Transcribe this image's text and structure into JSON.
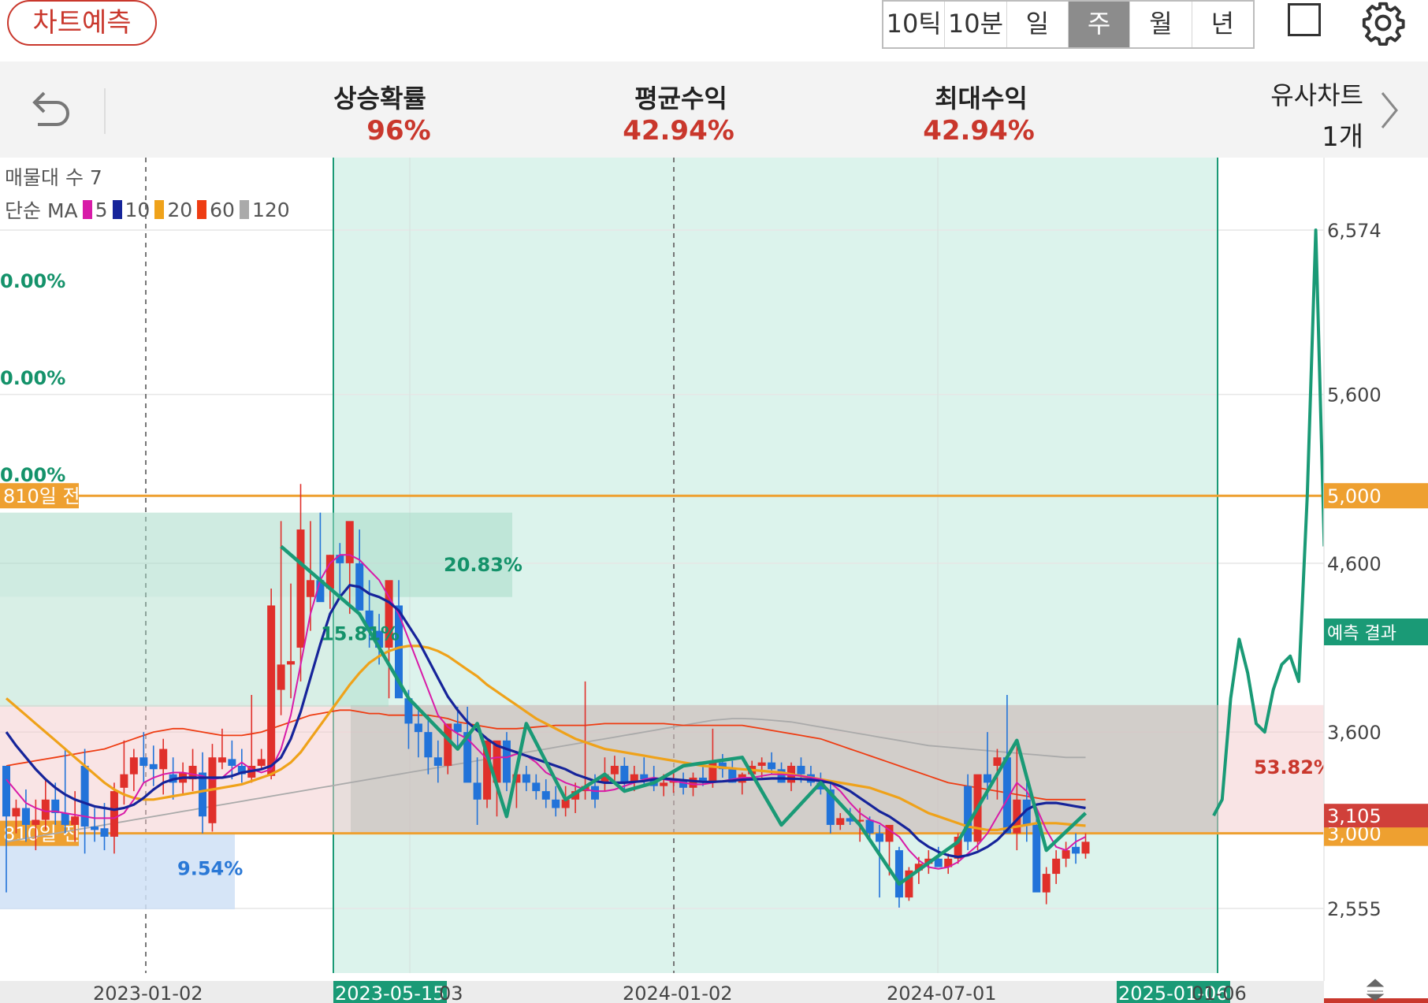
{
  "header": {
    "predict_button": "차트예측",
    "timeframes": [
      "10틱",
      "10분",
      "일",
      "주",
      "월",
      "년"
    ],
    "active_timeframe": "주"
  },
  "stats": {
    "rise_prob_label": "상승확률",
    "rise_prob_value": "96%",
    "avg_return_label": "평균수익",
    "avg_return_value": "42.94%",
    "max_return_label": "최대수익",
    "max_return_value": "42.94%",
    "similar_label": "유사차트",
    "similar_value": "1개"
  },
  "legend": {
    "volume_profile": "매물대 수 7",
    "ma_label": "단순 MA",
    "ma_periods": [
      "5",
      "10",
      "20",
      "60",
      "120"
    ],
    "ma_colors": [
      "#d81ba8",
      "#16249a",
      "#efa21a",
      "#ee3c12",
      "#aaaaaa"
    ]
  },
  "colors": {
    "up": "#e0302b",
    "down": "#2273d9",
    "pattern": "#1a9a76",
    "prediction": "#1a9a76",
    "level_line": "#eea030"
  },
  "chart_data": {
    "type": "candlestick",
    "y_axis_ticks": [
      "6,574",
      "5,600",
      "4,600",
      "3,600",
      "2,555"
    ],
    "y_tick_values": [
      6574,
      5600,
      4600,
      3600,
      2555
    ],
    "x_axis_labels": [
      "2023-01-02",
      "2023-05-15",
      "03",
      "2024-01-02",
      "2024-07-01",
      "2025-01-06",
      "01-06"
    ],
    "level_lines": [
      {
        "value": 5000,
        "value_label": "5,000",
        "left_label": "810일 전"
      },
      {
        "value": 3000,
        "value_label": "3,000",
        "left_label": "810일 전"
      }
    ],
    "current_price": "3,105",
    "current_price_value": 3105,
    "left_percent_labels": [
      "0.00%",
      "0.00%",
      "0.00%"
    ],
    "box_labels": [
      "20.83%",
      "15.81%",
      "9.54%",
      "53.82%"
    ],
    "prediction_label": "예측 결과",
    "ohlc": [
      [
        3400,
        3350,
        2650,
        3100
      ],
      [
        3100,
        3200,
        3000,
        3150
      ],
      [
        3150,
        3260,
        2950,
        3050
      ],
      [
        3050,
        3200,
        2900,
        3080
      ],
      [
        3080,
        3320,
        3020,
        3200
      ],
      [
        3200,
        3300,
        3050,
        3120
      ],
      [
        3120,
        3500,
        3000,
        3050
      ],
      [
        3050,
        3250,
        2950,
        3100
      ],
      [
        3400,
        3500,
        2880,
        3040
      ],
      [
        3040,
        3150,
        2950,
        3020
      ],
      [
        3030,
        3180,
        2900,
        2980
      ],
      [
        2980,
        3300,
        2880,
        3250
      ],
      [
        3270,
        3550,
        3170,
        3350
      ],
      [
        3350,
        3500,
        3250,
        3450
      ],
      [
        3450,
        3600,
        3300,
        3400
      ],
      [
        3410,
        3520,
        3280,
        3380
      ],
      [
        3380,
        3560,
        3230,
        3500
      ],
      [
        3350,
        3450,
        3200,
        3300
      ],
      [
        3300,
        3420,
        3230,
        3360
      ],
      [
        3320,
        3500,
        3250,
        3400
      ],
      [
        3360,
        3480,
        3000,
        3100
      ],
      [
        3060,
        3530,
        3010,
        3450
      ],
      [
        3420,
        3620,
        3380,
        3450
      ],
      [
        3440,
        3550,
        3320,
        3400
      ],
      [
        3400,
        3500,
        3300,
        3350
      ],
      [
        3330,
        3820,
        3300,
        3400
      ],
      [
        3400,
        3500,
        3380,
        3440
      ],
      [
        3340,
        4450,
        3320,
        4350
      ],
      [
        3850,
        4850,
        3700,
        4000
      ],
      [
        4000,
        4480,
        3800,
        4020
      ],
      [
        4100,
        5070,
        3900,
        4800
      ],
      [
        4400,
        4850,
        4200,
        4500
      ],
      [
        4500,
        4900,
        4450,
        4370
      ],
      [
        4450,
        4650,
        4330,
        4650
      ],
      [
        4650,
        4720,
        4400,
        4600
      ],
      [
        4600,
        4800,
        4300,
        4850
      ],
      [
        4600,
        4800,
        4450,
        4320
      ],
      [
        4320,
        4500,
        4100,
        4200
      ],
      [
        4200,
        4300,
        4000,
        4100
      ],
      [
        4100,
        4250,
        3800,
        4500
      ],
      [
        4350,
        4500,
        4150,
        3800
      ],
      [
        3800,
        3850,
        3500,
        3650
      ],
      [
        3650,
        3750,
        3450,
        3600
      ],
      [
        3600,
        3700,
        3350,
        3450
      ],
      [
        3450,
        3550,
        3300,
        3400
      ],
      [
        3400,
        3550,
        3350,
        3650
      ],
      [
        3650,
        3750,
        3500,
        3600
      ],
      [
        3600,
        3750,
        3400,
        3300
      ],
      [
        3300,
        3450,
        3050,
        3200
      ],
      [
        3200,
        3550,
        3150,
        3550
      ],
      [
        3300,
        3500,
        3100,
        3550
      ],
      [
        3550,
        3600,
        3250,
        3300
      ],
      [
        3300,
        3400,
        3150,
        3350
      ],
      [
        3350,
        3400,
        3250,
        3300
      ],
      [
        3300,
        3350,
        3200,
        3250
      ],
      [
        3250,
        3320,
        3150,
        3200
      ],
      [
        3200,
        3280,
        3100,
        3150
      ],
      [
        3150,
        3280,
        3100,
        3200
      ],
      [
        3200,
        3300,
        3120,
        3250
      ],
      [
        3250,
        3900,
        3200,
        3280
      ],
      [
        3280,
        3350,
        3150,
        3200
      ],
      [
        3300,
        3450,
        3250,
        3350
      ],
      [
        3350,
        3460,
        3300,
        3400
      ],
      [
        3400,
        3450,
        3250,
        3300
      ],
      [
        3300,
        3400,
        3250,
        3350
      ],
      [
        3350,
        3450,
        3280,
        3320
      ],
      [
        3320,
        3400,
        3250,
        3280
      ],
      [
        3280,
        3350,
        3220,
        3300
      ],
      [
        3300,
        3360,
        3240,
        3310
      ],
      [
        3310,
        3360,
        3230,
        3270
      ],
      [
        3270,
        3360,
        3220,
        3330
      ],
      [
        3330,
        3420,
        3280,
        3300
      ],
      [
        3300,
        3620,
        3270,
        3420
      ],
      [
        3420,
        3470,
        3330,
        3380
      ],
      [
        3380,
        3430,
        3300,
        3300
      ],
      [
        3300,
        3360,
        3230,
        3350
      ],
      [
        3350,
        3430,
        3320,
        3400
      ],
      [
        3400,
        3450,
        3330,
        3420
      ],
      [
        3420,
        3480,
        3350,
        3380
      ],
      [
        3380,
        3420,
        3300,
        3300
      ],
      [
        3300,
        3420,
        3250,
        3400
      ],
      [
        3400,
        3450,
        3300,
        3350
      ],
      [
        3350,
        3400,
        3280,
        3300
      ],
      [
        3300,
        3360,
        3230,
        3260
      ],
      [
        3260,
        3300,
        3000,
        3050
      ],
      [
        3050,
        3120,
        3020,
        3090
      ],
      [
        3090,
        3150,
        3050,
        3070
      ],
      [
        3070,
        3150,
        2950,
        3080
      ],
      [
        3080,
        3100,
        2950,
        3000
      ],
      [
        3000,
        3050,
        2620,
        2950
      ],
      [
        2950,
        3000,
        2750,
        3050
      ],
      [
        2900,
        2920,
        2560,
        2620
      ],
      [
        2620,
        2800,
        2600,
        2780
      ],
      [
        2780,
        2860,
        2700,
        2820
      ],
      [
        2820,
        2900,
        2760,
        2850
      ],
      [
        2850,
        2920,
        2800,
        2800
      ],
      [
        2800,
        2880,
        2760,
        2850
      ],
      [
        2850,
        3000,
        2820,
        2980
      ],
      [
        3280,
        3350,
        2900,
        2950
      ],
      [
        2950,
        3300,
        2900,
        3350
      ],
      [
        3350,
        3600,
        3200,
        3300
      ],
      [
        3400,
        3500,
        3200,
        3450
      ],
      [
        3450,
        3820,
        3300,
        3000
      ],
      [
        3000,
        3550,
        2900,
        3200
      ],
      [
        3200,
        3300,
        2950,
        3050
      ],
      [
        3050,
        3100,
        2700,
        2650
      ],
      [
        2650,
        2800,
        2580,
        2760
      ],
      [
        2760,
        2900,
        2700,
        2850
      ],
      [
        2850,
        2950,
        2800,
        2900
      ],
      [
        2920,
        3000,
        2820,
        2880
      ],
      [
        2880,
        3000,
        2850,
        2950
      ]
    ],
    "ma5": [
      3320,
      3250,
      3180,
      3150,
      3130,
      3130,
      3120,
      3110,
      3100,
      3090,
      3090,
      3090,
      3120,
      3200,
      3300,
      3330,
      3350,
      3360,
      3360,
      3350,
      3340,
      3320,
      3330,
      3380,
      3420,
      3380,
      3360,
      3380,
      3500,
      3700,
      4000,
      4300,
      4500,
      4600,
      4650,
      4650,
      4620,
      4560,
      4500,
      4400,
      4300,
      4150,
      4000,
      3850,
      3700,
      3630,
      3590,
      3560,
      3500,
      3440,
      3450,
      3450,
      3470,
      3460,
      3420,
      3360,
      3330,
      3300,
      3280,
      3260,
      3250,
      3250,
      3260,
      3280,
      3300,
      3320,
      3330,
      3320,
      3310,
      3300,
      3290,
      3290,
      3300,
      3310,
      3320,
      3330,
      3330,
      3340,
      3350,
      3350,
      3345,
      3340,
      3330,
      3320,
      3300,
      3250,
      3180,
      3120,
      3080,
      3060,
      3020,
      2980,
      2900,
      2840,
      2800,
      2790,
      2800,
      2830,
      2880,
      2930,
      3000,
      3100,
      3200,
      3300,
      3250,
      3150,
      3020,
      2920,
      2900,
      2950,
      2980
    ],
    "ma10": [
      3600,
      3520,
      3450,
      3380,
      3320,
      3270,
      3230,
      3200,
      3180,
      3160,
      3150,
      3140,
      3150,
      3170,
      3210,
      3260,
      3300,
      3320,
      3330,
      3330,
      3330,
      3330,
      3330,
      3340,
      3360,
      3370,
      3380,
      3400,
      3450,
      3560,
      3720,
      3920,
      4120,
      4300,
      4400,
      4470,
      4460,
      4420,
      4400,
      4370,
      4320,
      4230,
      4140,
      4030,
      3920,
      3810,
      3730,
      3660,
      3610,
      3560,
      3520,
      3500,
      3480,
      3460,
      3440,
      3420,
      3400,
      3380,
      3350,
      3330,
      3310,
      3300,
      3300,
      3300,
      3305,
      3310,
      3320,
      3325,
      3320,
      3315,
      3310,
      3305,
      3305,
      3308,
      3312,
      3318,
      3320,
      3322,
      3325,
      3325,
      3324,
      3322,
      3318,
      3310,
      3300,
      3280,
      3250,
      3210,
      3170,
      3130,
      3100,
      3060,
      3020,
      2960,
      2920,
      2890,
      2870,
      2860,
      2870,
      2890,
      2920,
      2960,
      3020,
      3080,
      3140,
      3170,
      3180,
      3180,
      3170,
      3160,
      3150
    ],
    "ma20": [
      3800,
      3750,
      3700,
      3650,
      3600,
      3550,
      3500,
      3450,
      3400,
      3350,
      3300,
      3260,
      3230,
      3210,
      3200,
      3200,
      3210,
      3220,
      3230,
      3240,
      3250,
      3260,
      3270,
      3280,
      3290,
      3310,
      3330,
      3350,
      3380,
      3420,
      3480,
      3560,
      3640,
      3720,
      3800,
      3880,
      3950,
      4010,
      4050,
      4080,
      4100,
      4110,
      4110,
      4100,
      4080,
      4050,
      4010,
      3970,
      3930,
      3880,
      3840,
      3800,
      3760,
      3720,
      3680,
      3650,
      3620,
      3590,
      3560,
      3540,
      3520,
      3500,
      3490,
      3480,
      3470,
      3460,
      3450,
      3440,
      3430,
      3420,
      3410,
      3400,
      3395,
      3390,
      3385,
      3380,
      3375,
      3370,
      3365,
      3360,
      3350,
      3340,
      3330,
      3320,
      3310,
      3300,
      3290,
      3280,
      3270,
      3250,
      3230,
      3210,
      3180,
      3150,
      3120,
      3100,
      3080,
      3060,
      3040,
      3030,
      3020,
      3020,
      3030,
      3040,
      3050,
      3060,
      3060,
      3060,
      3055,
      3050,
      3045
    ],
    "ma60": [
      3400,
      3410,
      3420,
      3430,
      3440,
      3450,
      3460,
      3470,
      3480,
      3490,
      3500,
      3520,
      3540,
      3560,
      3580,
      3600,
      3610,
      3620,
      3620,
      3610,
      3600,
      3590,
      3580,
      3580,
      3580,
      3590,
      3600,
      3620,
      3640,
      3660,
      3680,
      3700,
      3710,
      3720,
      3730,
      3730,
      3720,
      3710,
      3710,
      3700,
      3700,
      3700,
      3700,
      3700,
      3690,
      3680,
      3660,
      3650,
      3640,
      3630,
      3620,
      3620,
      3620,
      3625,
      3630,
      3635,
      3640,
      3640,
      3640,
      3640,
      3645,
      3650,
      3650,
      3650,
      3650,
      3650,
      3650,
      3650,
      3645,
      3640,
      3640,
      3640,
      3640,
      3640,
      3640,
      3640,
      3630,
      3620,
      3610,
      3600,
      3590,
      3580,
      3570,
      3560,
      3540,
      3520,
      3500,
      3480,
      3460,
      3440,
      3420,
      3400,
      3380,
      3360,
      3340,
      3320,
      3300,
      3290,
      3280,
      3270,
      3260,
      3250,
      3240,
      3230,
      3220,
      3210,
      3200,
      3200,
      3200,
      3200,
      3200
    ],
    "ma120": [
      2950,
      2960,
      2970,
      2980,
      2990,
      3000,
      3010,
      3020,
      3030,
      3040,
      3050,
      3060,
      3070,
      3080,
      3090,
      3100,
      3110,
      3120,
      3130,
      3140,
      3150,
      3160,
      3170,
      3180,
      3190,
      3200,
      3210,
      3220,
      3230,
      3240,
      3250,
      3260,
      3270,
      3280,
      3290,
      3300,
      3310,
      3320,
      3330,
      3340,
      3350,
      3360,
      3370,
      3380,
      3390,
      3400,
      3410,
      3420,
      3430,
      3440,
      3450,
      3460,
      3470,
      3480,
      3490,
      3500,
      3510,
      3520,
      3530,
      3540,
      3550,
      3560,
      3570,
      3580,
      3590,
      3600,
      3610,
      3620,
      3630,
      3640,
      3650,
      3660,
      3670,
      3675,
      3680,
      3680,
      3678,
      3675,
      3670,
      3665,
      3660,
      3650,
      3640,
      3630,
      3620,
      3610,
      3600,
      3590,
      3580,
      3570,
      3560,
      3550,
      3540,
      3530,
      3520,
      3515,
      3510,
      3505,
      3500,
      3495,
      3490,
      3485,
      3480,
      3475,
      3470,
      3465,
      3460,
      3455,
      3450,
      3450,
      3450
    ],
    "pattern_points": [
      [
        28,
        4700
      ],
      [
        36,
        4300
      ],
      [
        41,
        3800
      ],
      [
        46,
        3500
      ],
      [
        48,
        3650
      ],
      [
        51,
        3100
      ],
      [
        53,
        3650
      ],
      [
        57,
        3200
      ],
      [
        61,
        3350
      ],
      [
        63,
        3250
      ],
      [
        66,
        3300
      ],
      [
        69,
        3400
      ],
      [
        75,
        3450
      ],
      [
        79,
        3050
      ],
      [
        83,
        3300
      ],
      [
        87,
        3050
      ],
      [
        91,
        2700
      ],
      [
        97,
        2950
      ],
      [
        103,
        3550
      ],
      [
        106,
        2900
      ],
      [
        110,
        3120
      ]
    ],
    "prediction_points": [
      [
        0,
        3105
      ],
      [
        1,
        3200
      ],
      [
        2,
        3800
      ],
      [
        3,
        4150
      ],
      [
        4,
        3950
      ],
      [
        5,
        3650
      ],
      [
        6,
        3600
      ],
      [
        7,
        3850
      ],
      [
        8,
        4000
      ],
      [
        9,
        4050
      ],
      [
        10,
        3900
      ],
      [
        11,
        5000
      ],
      [
        12,
        6574
      ],
      [
        13,
        4700
      ]
    ]
  }
}
